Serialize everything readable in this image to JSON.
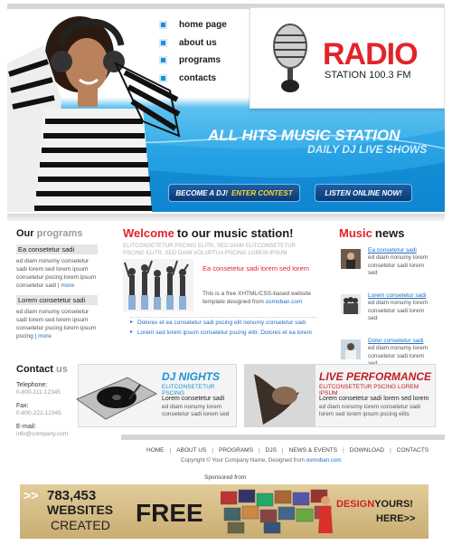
{
  "nav": {
    "items": [
      {
        "label": "home page"
      },
      {
        "label": "about us"
      },
      {
        "label": "programs"
      },
      {
        "label": "contacts"
      }
    ]
  },
  "logo": {
    "title": "RADIO",
    "subtitle": "STATION 100.3 FM"
  },
  "banner": {
    "title": "ALL HITS MUSIC STATION",
    "subtitle": "DAILY DJ LIVE SHOWS",
    "btn_dj_prefix": "BECOME A DJ!",
    "btn_dj_highlight": "ENTER CONTEST",
    "btn_listen": "LISTEN ONLINE NOW!"
  },
  "programs": {
    "title_dark": "Our",
    "title_light": "programs",
    "items": [
      {
        "title": "Ea consetetur sadi",
        "text": "ed diam nonumy consetetur sadi lorem sed lorem ipsum consetetur pscing lorem ipsum consetetur sadi",
        "more": "more"
      },
      {
        "title": "Lorem consetetur sadi",
        "text": "ed diam nonumy consetetur sadi lorem sed lorem ipsum consetetur pscing lorem ipsum pscing",
        "more": "more"
      }
    ]
  },
  "welcome": {
    "title_red": "Welcome",
    "title_dark": "to our music station!",
    "subtitle": "ELITCONSETETUR PSCING ELITR, SED DIAM ELITCONSETETUR PSCING ELITR, SED DIAM VOLUPTUA PSCING LOREM IPSUM",
    "red_text": "Ea consetetur sadi lorem sed lorem",
    "body_prefix": "This is a free XHTML/CSS-based website template designed from",
    "body_link": "osmoban.com",
    "list": [
      "Dolores et ea consetetur sadi pscing elit nonumy consetetur sadi",
      "Lorem sed lorem ipsum consetetur pscing elitr. Dolores et ea lorem"
    ]
  },
  "news": {
    "title_red": "Music",
    "title_dark": "news",
    "items": [
      {
        "title": "Ea consetetur sadi",
        "text": "ed diam nonumy lorem consetetur sadi lorem sed"
      },
      {
        "title": "Lorem consetetur sadi",
        "text": "ed diam nonumy lorem consetetur sadi lorem sed"
      },
      {
        "title": "Dolor consetetur sadi",
        "text": "ed diam nonumy lorem consetetur sadi lorem sed"
      }
    ]
  },
  "contact": {
    "title_dark": "Contact",
    "title_light": "us",
    "telephone_label": "Telephone:",
    "telephone": "0-800-111-12345",
    "fax_label": "Fax:",
    "fax": "0-800-222-12345",
    "email_label": "E-mail:",
    "email": "info@company.com"
  },
  "dj": {
    "title": "DJ NIGHTS",
    "subtitle": "ELITCONSETETUR PSCING",
    "lead": "Lorem consetetur sadi",
    "text": "ed diam nonumy lorem consetetur sadi lorem sed"
  },
  "live": {
    "title": "LIVE PERFORMANCE",
    "subtitle": "ELITCONSETETUR PSCING LOREM IPSUM",
    "lead": "Lorem consetetur sadi lorem sed lorem",
    "text": "ed diam nonumy lorem consetetur sadi lorem sed lorem ipsum pscing elits"
  },
  "footer": {
    "links": [
      "HOME",
      "ABOUT US",
      "PROGRAMS",
      "DJS",
      "NEWS & EVENTS",
      "DOWNLOAD",
      "CONTACTS"
    ],
    "copyright_prefix": "Copyright © Your Company Name, Designed from",
    "copyright_link": "osmoban.com",
    "sponsored": "Sponsored from"
  },
  "ad": {
    "arrows": ">>",
    "number": "783,453",
    "websites": "WEBSITES",
    "created": "CREATED",
    "free": "FREE",
    "design_red": "DESIGN",
    "design_dark": "YOURS!",
    "here": "HERE>>"
  },
  "colors": {
    "accent_blue": "#1b93d3",
    "accent_red": "#e2232a"
  }
}
